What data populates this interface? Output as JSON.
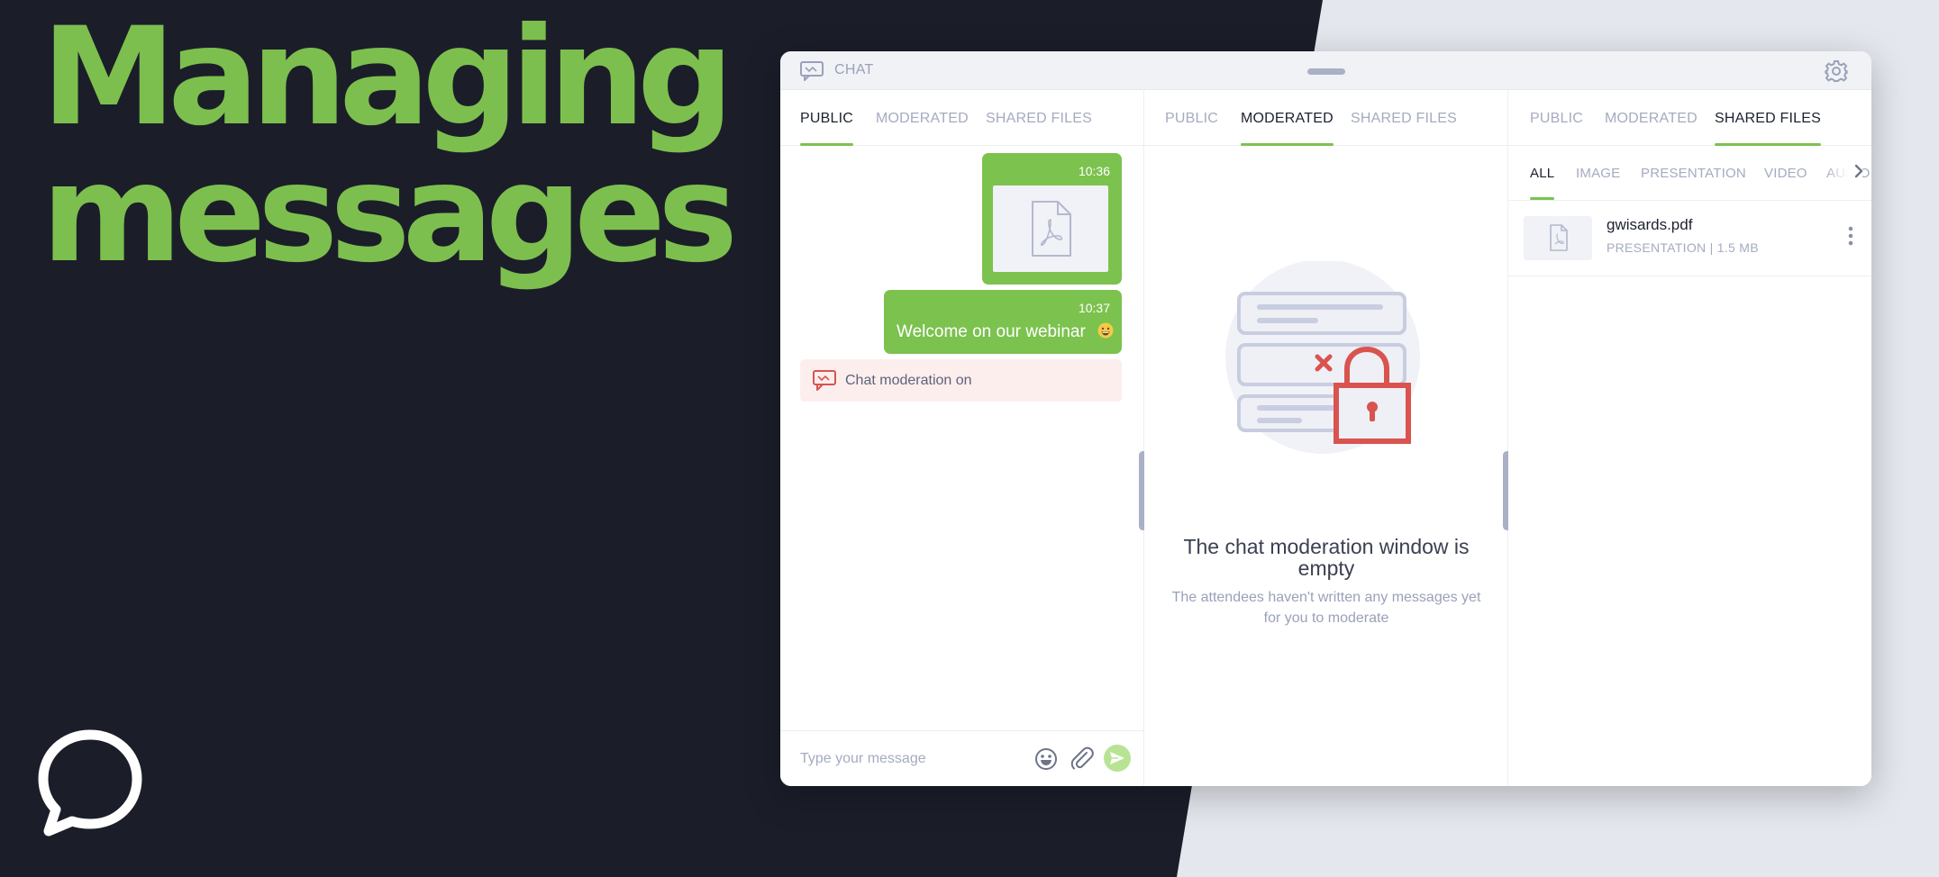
{
  "headline": {
    "line1": "Managing",
    "line2": "messages"
  },
  "window": {
    "title": "CHAT"
  },
  "columns": [
    {
      "tabs": [
        "PUBLIC",
        "MODERATED",
        "SHARED FILES"
      ],
      "active_tab": "PUBLIC"
    },
    {
      "tabs": [
        "PUBLIC",
        "MODERATED",
        "SHARED FILES"
      ],
      "active_tab": "MODERATED"
    },
    {
      "tabs": [
        "PUBLIC",
        "MODERATED",
        "SHARED FILES"
      ],
      "active_tab": "SHARED FILES"
    }
  ],
  "messages": [
    {
      "time": "10:36",
      "type": "file"
    },
    {
      "time": "10:37",
      "type": "text",
      "text": "Welcome on our webinar"
    }
  ],
  "system_note": "Chat moderation on",
  "composer": {
    "placeholder": "Type your message"
  },
  "moderation_empty": {
    "title": "The chat moderation window is empty",
    "subtitle": "The attendees haven't written any messages yet for you to moderate"
  },
  "shared_files": {
    "filters": [
      "ALL",
      "IMAGE",
      "PRESENTATION",
      "VIDEO",
      "AUDIO"
    ],
    "active_filter": "ALL",
    "files": [
      {
        "name": "gwisards.pdf",
        "meta": "PRESENTATION | 1.5 MB"
      }
    ]
  },
  "colors": {
    "accent": "#7cc24e",
    "dark_bg": "#1b1e29",
    "alert_red": "#d9534f",
    "note_bg": "#fdeeee"
  }
}
